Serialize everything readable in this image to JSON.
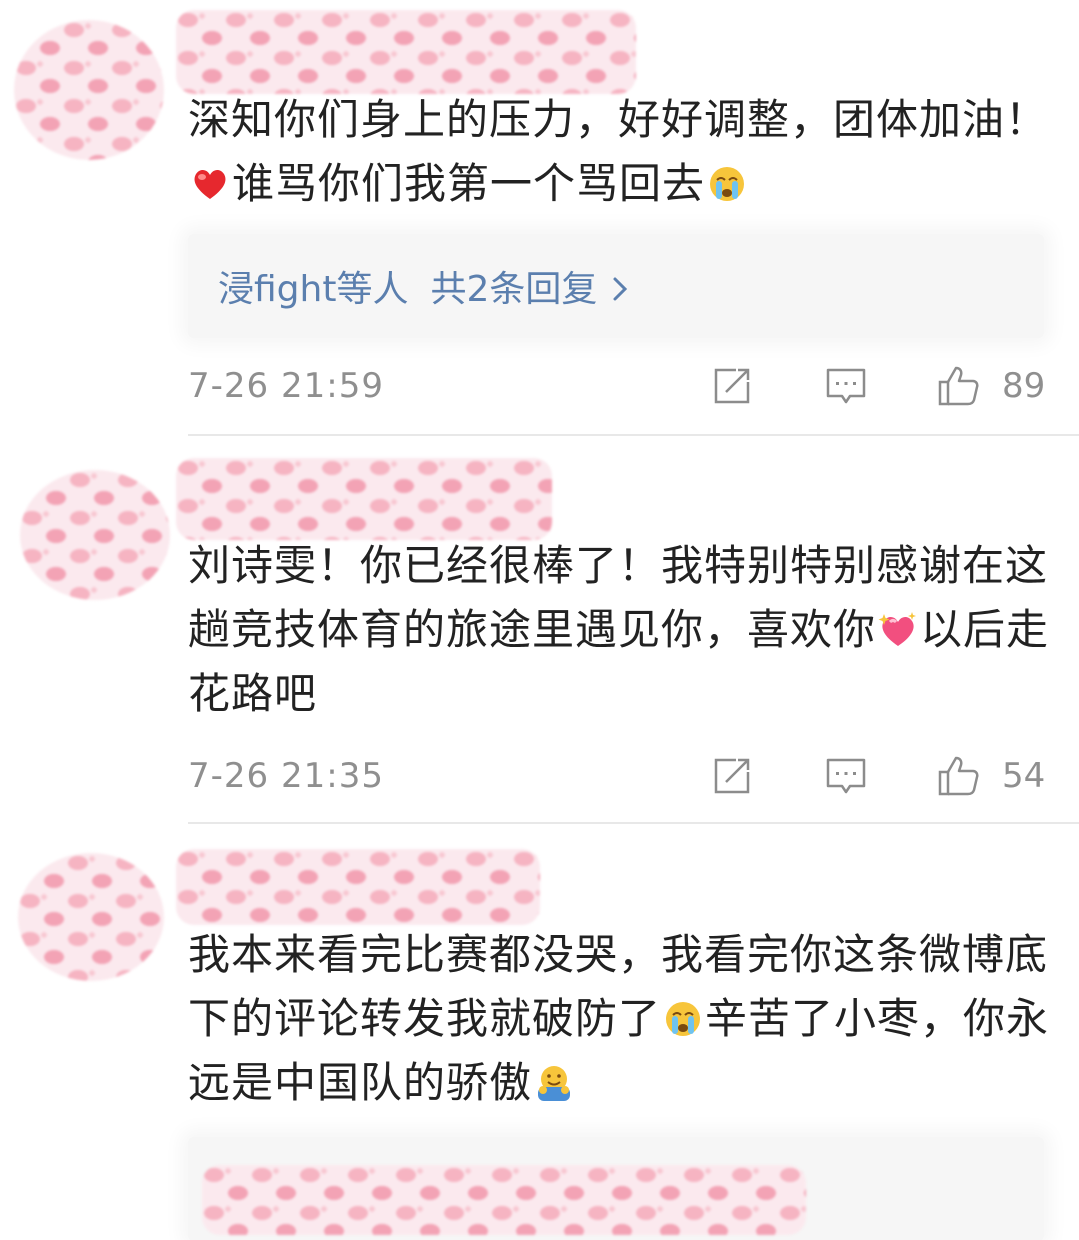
{
  "comments": [
    {
      "text_a": "深知你们身上的压力，好好调整，团体加油！",
      "emoji_a": "red-heart-icon",
      "text_b": "谁骂你们我第一个骂回去",
      "emoji_b": "crying-face-icon",
      "reply": {
        "names": "浸fight等人",
        "count": "共2条回复"
      },
      "time": "7-26 21:59",
      "likes": "89"
    },
    {
      "text_a": "刘诗雯！你已经很棒了！我特别特别感谢在这趟竞技体育的旅途里遇见你，喜欢你",
      "emoji_a": "sparkling-heart-icon",
      "text_b": "以后走花路吧",
      "time": "7-26 21:35",
      "likes": "54"
    },
    {
      "text_a": "我本来看完比赛都没哭，我看完你这条微博底下的评论转发我就破防了",
      "emoji_a": "crying-face-icon",
      "text_b": "辛苦了小枣，你永远是中国队的骄傲",
      "emoji_b": "hugging-face-icon"
    }
  ],
  "colors": {
    "text": "#222222",
    "reply_link": "#5b7fae",
    "meta": "#8f8f8f",
    "reply_bg": "#f6f6f6",
    "mask_pink": "#f6b4c2"
  }
}
